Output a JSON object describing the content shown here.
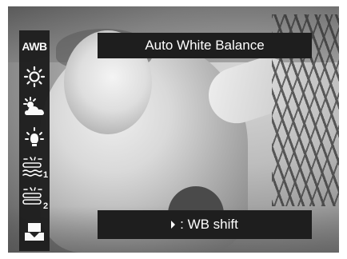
{
  "header": {
    "title": "Auto White Balance"
  },
  "sidebar": {
    "items": [
      {
        "id": "awb",
        "label": "AWB",
        "icon": "awb-text-icon"
      },
      {
        "id": "daylight",
        "icon": "sun-icon"
      },
      {
        "id": "cloudy",
        "icon": "cloudy-icon"
      },
      {
        "id": "tungsten",
        "icon": "tungsten-bulb-icon"
      },
      {
        "id": "fluorescent1",
        "icon": "fluorescent-icon",
        "suffix": "1"
      },
      {
        "id": "fluorescent2",
        "icon": "fluorescent-icon",
        "suffix": "2"
      },
      {
        "id": "custom",
        "icon": "custom-wb-icon"
      }
    ]
  },
  "footer": {
    "hint_text": ": WB shift",
    "hint_icon": "right-arrow-icon"
  },
  "colors": {
    "overlay": "#1e1e1e",
    "text": "#ffffff"
  }
}
